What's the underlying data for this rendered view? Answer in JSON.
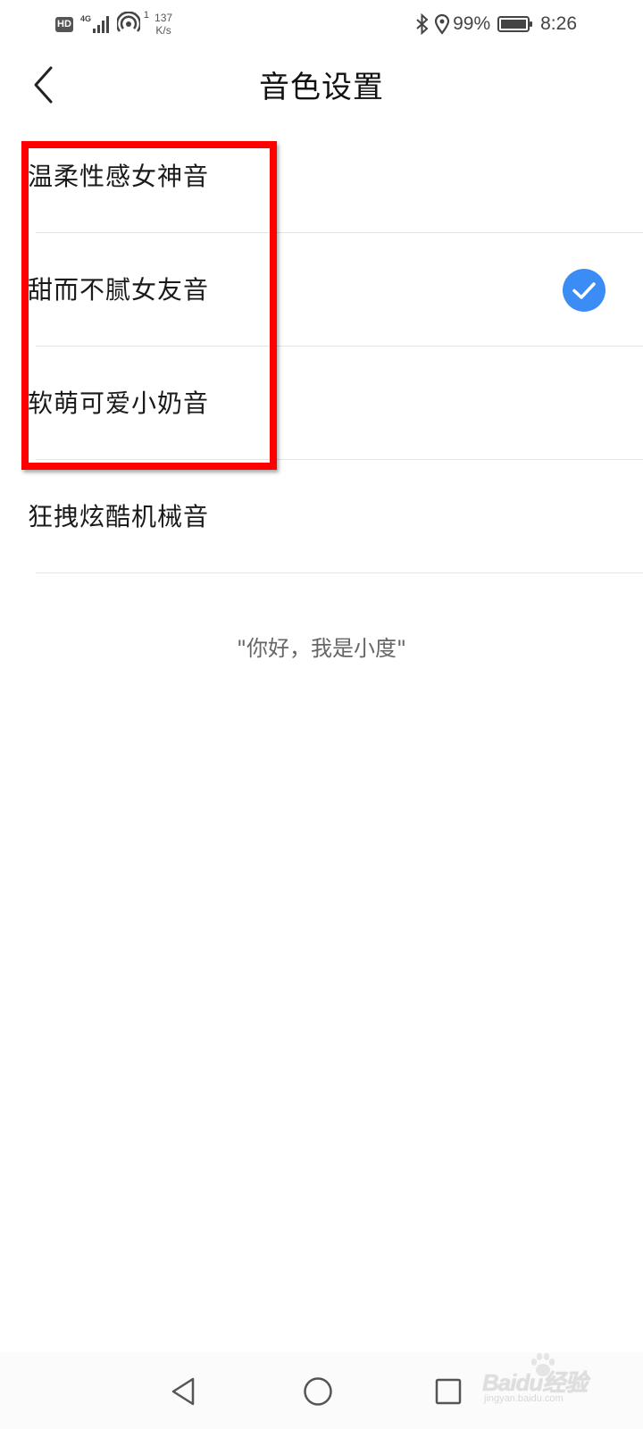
{
  "status_bar": {
    "hd_badge": "HD",
    "network_type": "4G",
    "hotspot_count": "1",
    "speed_value": "137",
    "speed_unit": "K/s",
    "battery_percent": "99%",
    "time": "8:26",
    "icons": [
      "signal-icon",
      "hotspot-icon",
      "bluetooth-icon",
      "location-icon",
      "battery-icon"
    ]
  },
  "header": {
    "title": "音色设置",
    "back_icon": "chevron-left-icon"
  },
  "voices": {
    "items": [
      {
        "label": "温柔性感女神音",
        "selected": false
      },
      {
        "label": "甜而不腻女友音",
        "selected": true
      },
      {
        "label": "软萌可爱小奶音",
        "selected": false
      },
      {
        "label": "狂拽炫酷机械音",
        "selected": false
      }
    ],
    "selected_color": "#3b8cf5"
  },
  "preview": {
    "text": "\"你好，我是小度\""
  },
  "annotation": {
    "highlight_color": "#ff0000"
  },
  "nav_bar": {
    "icons": [
      "nav-back-icon",
      "nav-home-icon",
      "nav-recent-icon"
    ]
  },
  "watermark": {
    "logo": "Baidu经验",
    "site": "jingyan.baidu.com"
  }
}
